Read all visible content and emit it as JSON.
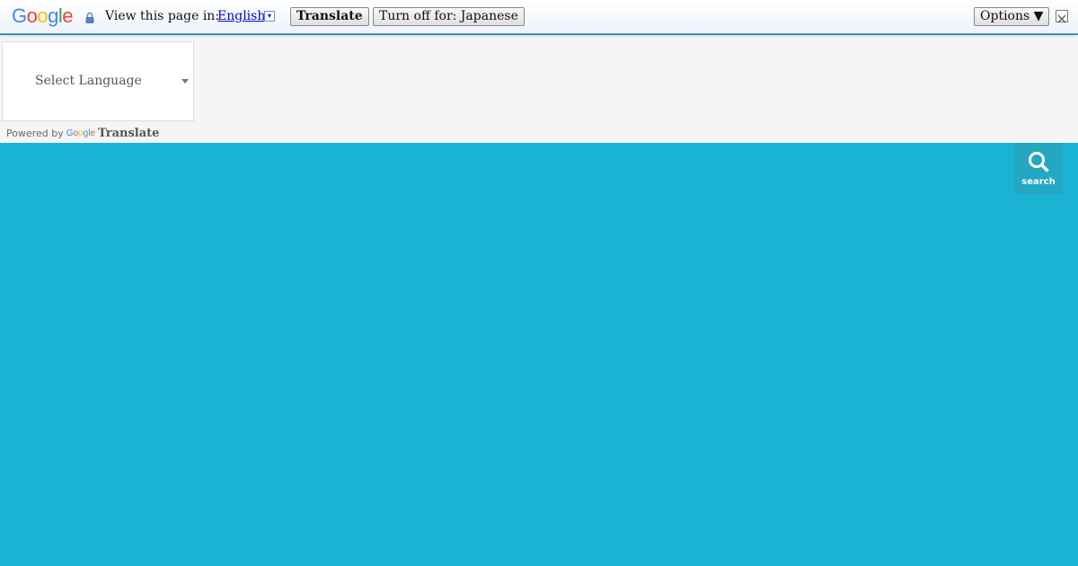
{
  "translate_bar": {
    "logo_letters": [
      "G",
      "o",
      "o",
      "g",
      "l",
      "e"
    ],
    "prompt": "View this page in:",
    "language": "English",
    "language_arrow": "▾",
    "translate_button": "Translate",
    "turn_off_button": "Turn off for: Japanese",
    "options_button": "Options ▼",
    "close_icon": "close-icon",
    "lock_icon": "lock-icon"
  },
  "widget": {
    "select_label": "Select Language",
    "powered_by": "Powered by",
    "mini_logo_letters": [
      "G",
      "o",
      "o",
      "g",
      "l",
      "e"
    ],
    "brand": "Translate"
  },
  "search": {
    "label": "search",
    "icon": "search-icon"
  },
  "colors": {
    "page_background": "#1bb3d3",
    "search_button": "#23a7c2",
    "strip_background": "#f5f5f5",
    "bar_border": "#6b90da"
  }
}
